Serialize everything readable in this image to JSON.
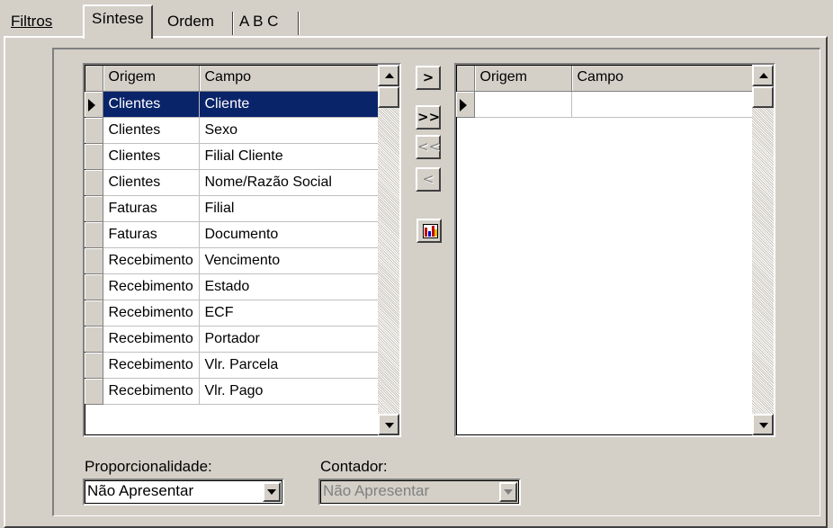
{
  "tabs": [
    {
      "label": "Filtros"
    },
    {
      "label": "Síntese"
    },
    {
      "label": "Ordem"
    },
    {
      "label": "A B C"
    }
  ],
  "left_grid": {
    "columns": [
      "Origem",
      "Campo"
    ],
    "rows": [
      {
        "origem": "Clientes",
        "campo": "Cliente"
      },
      {
        "origem": "Clientes",
        "campo": "Sexo"
      },
      {
        "origem": "Clientes",
        "campo": "Filial Cliente"
      },
      {
        "origem": "Clientes",
        "campo": "Nome/Razão Social"
      },
      {
        "origem": "Faturas",
        "campo": "Filial"
      },
      {
        "origem": "Faturas",
        "campo": "Documento"
      },
      {
        "origem": "Recebimento",
        "campo": "Vencimento"
      },
      {
        "origem": "Recebimento",
        "campo": "Estado"
      },
      {
        "origem": "Recebimento",
        "campo": "ECF"
      },
      {
        "origem": "Recebimento",
        "campo": "Portador"
      },
      {
        "origem": "Recebimento",
        "campo": "Vlr. Parcela"
      },
      {
        "origem": "Recebimento",
        "campo": "Vlr. Pago"
      }
    ]
  },
  "right_grid": {
    "columns": [
      "Origem",
      "Campo"
    ],
    "rows": [
      {
        "origem": "",
        "campo": ""
      }
    ]
  },
  "transfer_buttons": {
    "add_one": ">",
    "add_all": ">>",
    "remove_all": "<<",
    "remove_one": "<"
  },
  "proporcionalidade": {
    "label": "Proporcionalidade:",
    "value": "Não Apresentar"
  },
  "contador": {
    "label": "Contador:",
    "value": "Não Apresentar"
  },
  "colors": {
    "selection": "#0a246a",
    "face": "#d4d0c8"
  }
}
